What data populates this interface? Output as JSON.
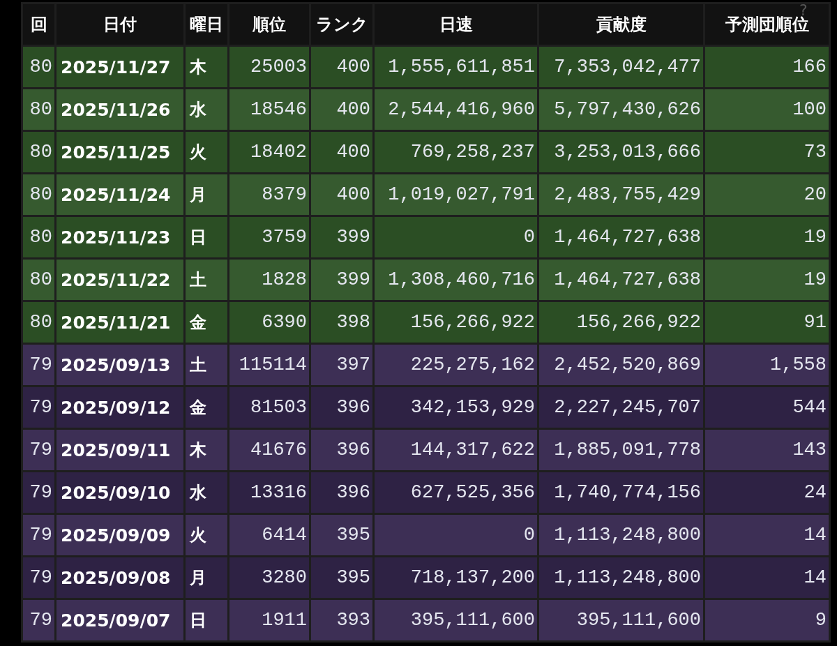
{
  "help_mark": "?",
  "table": {
    "columns": [
      "回",
      "日付",
      "曜日",
      "順位",
      "ランク",
      "日速",
      "貢献度",
      "予測団順位"
    ],
    "rows": [
      {
        "cells": [
          "80",
          "2025/11/27",
          "木",
          "25003",
          "400",
          "1,555,611,851",
          "7,353,042,477",
          "166"
        ],
        "color": "#2b4e24"
      },
      {
        "cells": [
          "80",
          "2025/11/26",
          "水",
          "18546",
          "400",
          "2,544,416,960",
          "5,797,430,626",
          "100"
        ],
        "color": "#365a2f"
      },
      {
        "cells": [
          "80",
          "2025/11/25",
          "火",
          "18402",
          "400",
          "769,258,237",
          "3,253,013,666",
          "73"
        ],
        "color": "#2b4e24"
      },
      {
        "cells": [
          "80",
          "2025/11/24",
          "月",
          "8379",
          "400",
          "1,019,027,791",
          "2,483,755,429",
          "20"
        ],
        "color": "#365a2f"
      },
      {
        "cells": [
          "80",
          "2025/11/23",
          "日",
          "3759",
          "399",
          "0",
          "1,464,727,638",
          "19"
        ],
        "color": "#2b4e24"
      },
      {
        "cells": [
          "80",
          "2025/11/22",
          "土",
          "1828",
          "399",
          "1,308,460,716",
          "1,464,727,638",
          "19"
        ],
        "color": "#365a2f"
      },
      {
        "cells": [
          "80",
          "2025/11/21",
          "金",
          "6390",
          "398",
          "156,266,922",
          "156,266,922",
          "91"
        ],
        "color": "#2b4e24"
      },
      {
        "cells": [
          "79",
          "2025/09/13",
          "土",
          "115114",
          "397",
          "225,275,162",
          "2,452,520,869",
          "1,558"
        ],
        "color": "#3d2f55"
      },
      {
        "cells": [
          "79",
          "2025/09/12",
          "金",
          "81503",
          "396",
          "342,153,929",
          "2,227,245,707",
          "544"
        ],
        "color": "#2e2244"
      },
      {
        "cells": [
          "79",
          "2025/09/11",
          "木",
          "41676",
          "396",
          "144,317,622",
          "1,885,091,778",
          "143"
        ],
        "color": "#3d2f55"
      },
      {
        "cells": [
          "79",
          "2025/09/10",
          "水",
          "13316",
          "396",
          "627,525,356",
          "1,740,774,156",
          "24"
        ],
        "color": "#2e2244"
      },
      {
        "cells": [
          "79",
          "2025/09/09",
          "火",
          "6414",
          "395",
          "0",
          "1,113,248,800",
          "14"
        ],
        "color": "#3d2f55"
      },
      {
        "cells": [
          "79",
          "2025/09/08",
          "月",
          "3280",
          "395",
          "718,137,200",
          "1,113,248,800",
          "14"
        ],
        "color": "#2e2244"
      },
      {
        "cells": [
          "79",
          "2025/09/07",
          "日",
          "1911",
          "393",
          "395,111,600",
          "395,111,600",
          "9"
        ],
        "color": "#3d2f55"
      }
    ]
  }
}
